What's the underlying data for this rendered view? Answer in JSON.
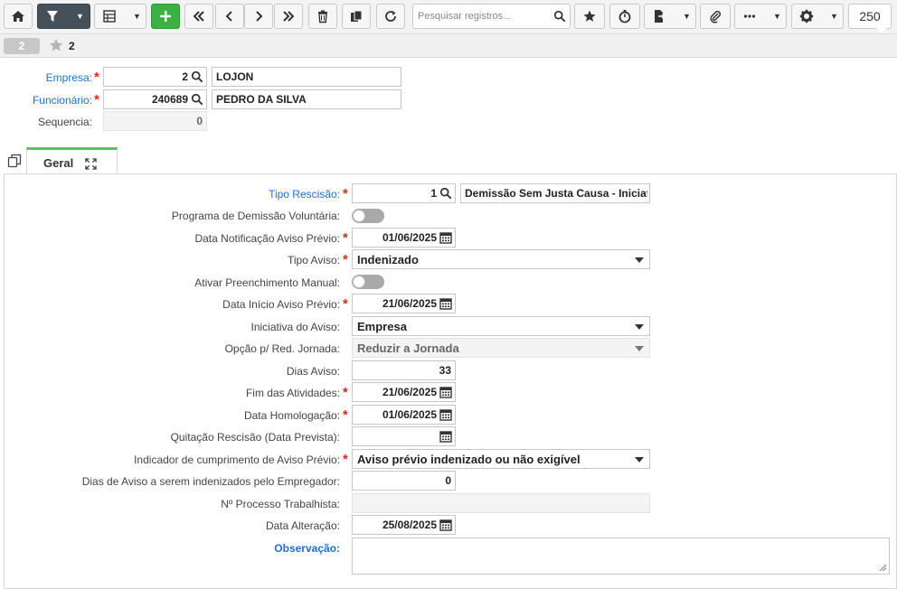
{
  "toolbar": {
    "search_placeholder": "Pesquisar registros...",
    "record_count": "250"
  },
  "record": {
    "index_pill": "2",
    "record_label": "2"
  },
  "header": {
    "empresa": {
      "label": "Empresa:",
      "code": "2",
      "name": "LOJON"
    },
    "funcionario": {
      "label": "Funcionário:",
      "code": "240689",
      "name": "PEDRO DA SILVA"
    },
    "sequencia": {
      "label": "Sequencia:",
      "value": "0"
    }
  },
  "tabs": [
    {
      "label": "Geral"
    }
  ],
  "form": {
    "tipo_rescisao": {
      "label": "Tipo Rescisão:",
      "code": "1",
      "desc": "Demissão Sem Justa Causa - Iniciativa"
    },
    "pdv": {
      "label": "Programa de Demissão Voluntária:"
    },
    "data_notificacao": {
      "label": "Data Notificação Aviso Prévio:",
      "value": "01/06/2025"
    },
    "tipo_aviso": {
      "label": "Tipo Aviso:",
      "value": "Indenizado"
    },
    "ativar_manual": {
      "label": "Ativar Preenchimento Manual:"
    },
    "data_inicio": {
      "label": "Data Início Aviso Prévio:",
      "value": "21/06/2025"
    },
    "iniciativa": {
      "label": "Iniciativa do Aviso:",
      "value": "Empresa"
    },
    "opcao_red": {
      "label": "Opção p/ Red. Jornada:",
      "value": "Reduzir a Jornada"
    },
    "dias_aviso": {
      "label": "Dias Aviso:",
      "value": "33"
    },
    "fim_atividades": {
      "label": "Fim das Atividades:",
      "value": "21/06/2025"
    },
    "data_homologacao": {
      "label": "Data Homologação:",
      "value": "01/06/2025"
    },
    "quitacao": {
      "label": "Quitação Rescisão (Data Prevista):",
      "value": ""
    },
    "indicador": {
      "label": "Indicador de cumprimento de Aviso Prévio:",
      "value": "Aviso prévio indenizado ou não exigível"
    },
    "dias_indenizados": {
      "label": "Dias de Aviso a serem indenizados pelo Empregador:",
      "value": "0"
    },
    "processo": {
      "label": "Nº Processo Trabalhista:",
      "value": ""
    },
    "data_alteracao": {
      "label": "Data Alteração:",
      "value": "25/08/2025"
    },
    "observacao": {
      "label": "Observação:"
    }
  }
}
